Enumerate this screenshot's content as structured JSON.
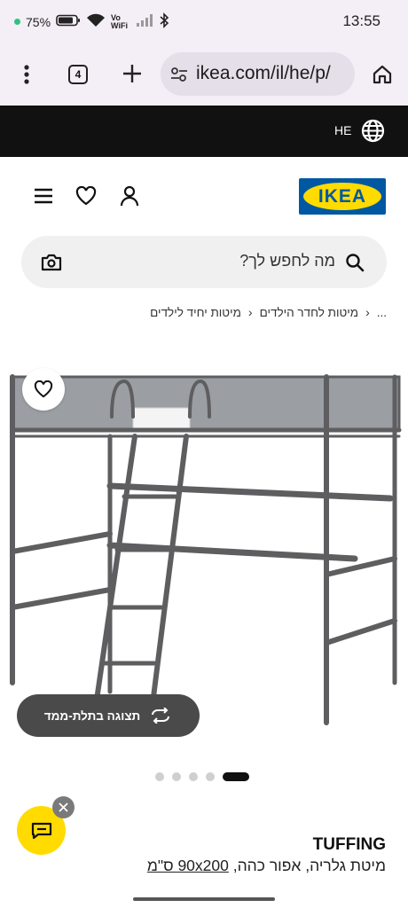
{
  "status_bar": {
    "battery": "75%",
    "network_label": "Vo WiFi",
    "time": "13:55"
  },
  "browser": {
    "tab_count": "4",
    "url": "ikea.com/il/he/p/"
  },
  "lang_bar": {
    "language": "HE"
  },
  "header": {
    "logo_text": "IKEA",
    "brand_blue": "#0058a3",
    "brand_yellow": "#ffdb00"
  },
  "search": {
    "placeholder": "מה לחפש לך?"
  },
  "breadcrumb": {
    "items": [
      "...",
      "מיטות לחדר הילדים",
      "מיטות יחיד לילדים"
    ]
  },
  "gallery": {
    "view_3d_label": "תצוגה בתלת-ממד",
    "slide_count": 5,
    "active_slide": 5
  },
  "product": {
    "name": "TUFFING",
    "desc_prefix": "מיטת גלריה, אפור כהה, ",
    "size": "90x200",
    "unit": " ס\"מ"
  }
}
